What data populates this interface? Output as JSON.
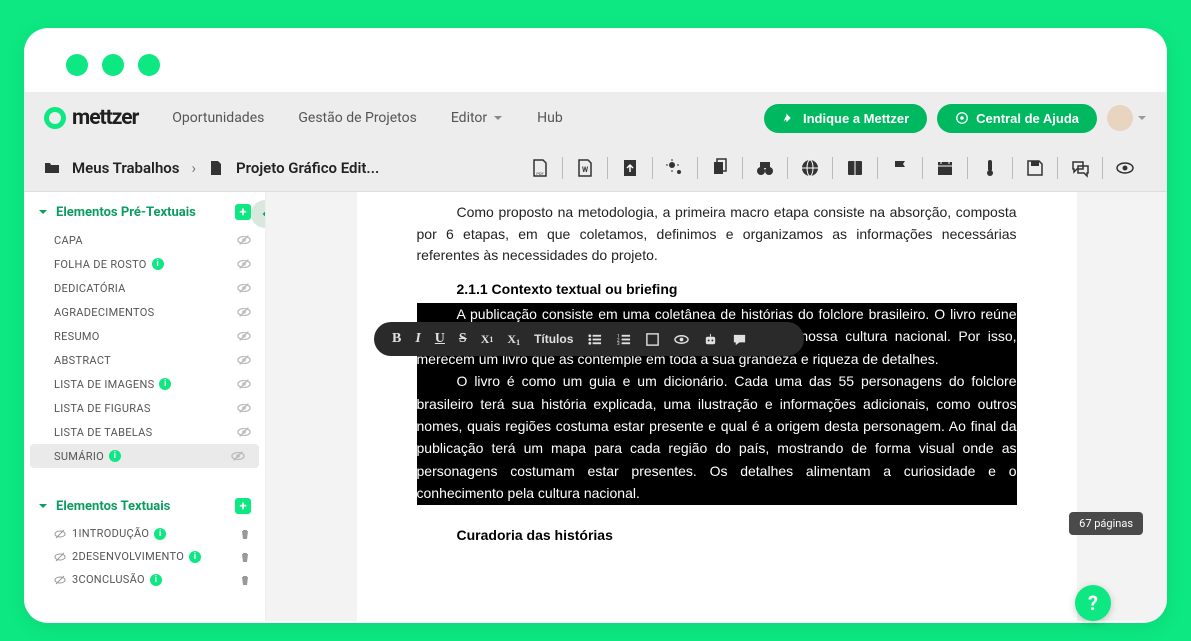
{
  "nav": {
    "brand": "mettzer",
    "links": [
      "Oportunidades",
      "Gestão de Projetos",
      "Editor",
      "Hub"
    ],
    "cta1": "Indique a Mettzer",
    "cta2": "Central de Ajuda"
  },
  "breadcrumb": {
    "root": "Meus Trabalhos",
    "current": "Projeto Gráfico Edit..."
  },
  "sidebar": {
    "section1": "Elementos Pré-Textuais",
    "section2": "Elementos Textuais",
    "pre": [
      {
        "label": "CAPA",
        "info": false
      },
      {
        "label": "FOLHA DE ROSTO",
        "info": true
      },
      {
        "label": "DEDICATÓRIA",
        "info": false
      },
      {
        "label": "AGRADECIMENTOS",
        "info": false
      },
      {
        "label": "RESUMO",
        "info": false
      },
      {
        "label": "ABSTRACT",
        "info": false
      },
      {
        "label": "LISTA DE IMAGENS",
        "info": true
      },
      {
        "label": "LISTA DE FIGURAS",
        "info": false
      },
      {
        "label": "LISTA DE TABELAS",
        "info": false
      },
      {
        "label": "SUMÁRIO",
        "info": true,
        "active": true
      }
    ],
    "text": [
      {
        "num": "1",
        "label": "INTRODUÇÃO",
        "info": true
      },
      {
        "num": "2",
        "label": "DESENVOLVIMENTO",
        "info": true
      },
      {
        "num": "3",
        "label": "CONCLUSÃO",
        "info": true
      }
    ]
  },
  "doc": {
    "intro": "Como proposto na metodologia, a primeira macro etapa consiste na absorção, composta por 6 etapas, em que coletamos, definimos e organizamos as informações necessárias referentes às necessidades do projeto.",
    "sub1": "2.1.1 Contexto textual ou briefing",
    "sel_p1": "A publicação consiste em uma coletânea de histórias do folclore brasileiro. O livro reúne algumas histórias do nosso folclore, que fazem parte da nossa cultura nacional. Por isso, merecem um livro que as contemple em toda a sua grandeza e riqueza de detalhes.",
    "sel_p2": "O livro é como um guia e um dicionário. Cada uma das 55 personagens do folclore brasileiro terá sua história explicada, uma ilustração e informações adicionais, como outros nomes, quais regiões costuma estar presente e qual é a origem desta personagem. Ao final da publicação terá um mapa para cada região do país, mostrando de forma visual onde as personagens costumam estar presentes. Os detalhes alimentam a curiosidade e o conhecimento pela cultura nacional.",
    "sub2": "Curadoria das histórias"
  },
  "floatbar": {
    "titulos": "Títulos"
  },
  "footer": {
    "pages": "67 páginas",
    "help": "?"
  }
}
